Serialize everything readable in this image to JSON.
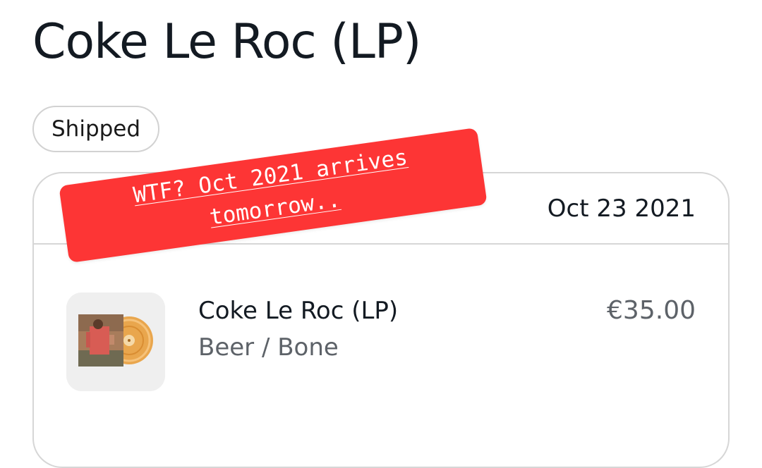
{
  "page": {
    "title": "Coke Le Roc (LP)"
  },
  "order": {
    "status": "Shipped",
    "date": "Oct 23 2021"
  },
  "item": {
    "title": "Coke Le Roc (LP)",
    "variant": "Beer / Bone",
    "price": "€35.00"
  },
  "annotation": {
    "line1": "WTF? Oct 2021 arrives",
    "line2": "tomorrow..",
    "color": "#fd3535"
  }
}
